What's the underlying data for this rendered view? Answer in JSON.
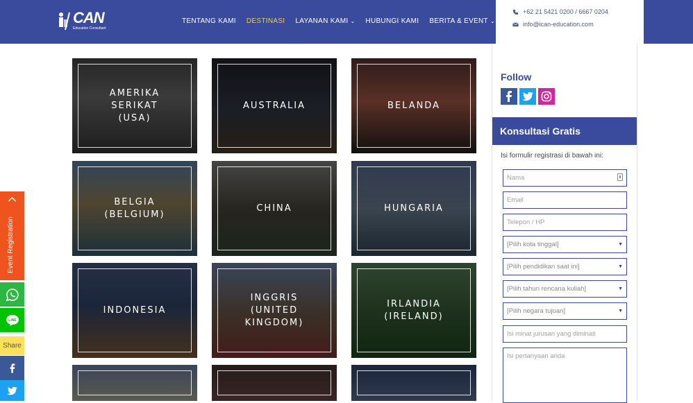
{
  "header": {
    "logo_text": "CAN",
    "logo_sub": "Education Consultant",
    "nav": [
      {
        "label": "TENTANG KAMI",
        "active": false,
        "dropdown": false
      },
      {
        "label": "DESTINASI",
        "active": true,
        "dropdown": false
      },
      {
        "label": "LAYANAN KAMI",
        "active": false,
        "dropdown": true
      },
      {
        "label": "HUBUNGI KAMI",
        "active": false,
        "dropdown": false
      },
      {
        "label": "BERITA & EVENT",
        "active": false,
        "dropdown": true
      }
    ],
    "search_icon": "search-icon",
    "phone": "+62 21 5421 0200 / 6667 0204",
    "email": "info@ican-education.com",
    "brand_color": "#3a4a9c",
    "active_color": "#f0c95a"
  },
  "destinations": [
    {
      "label": "AMERIKA\nSERIKAT\n(USA)"
    },
    {
      "label": "AUSTRALIA"
    },
    {
      "label": "BELANDA"
    },
    {
      "label": "BELGIA\n(BELGIUM)"
    },
    {
      "label": "CHINA"
    },
    {
      "label": "HUNGARIA"
    },
    {
      "label": "INDONESIA"
    },
    {
      "label": "INGGRIS\n(UNITED\nKINGDOM)"
    },
    {
      "label": "IRLANDIA\n(IRELAND)"
    },
    {
      "label": ""
    },
    {
      "label": ""
    },
    {
      "label": ""
    }
  ],
  "sidebar": {
    "follow_title": "Follow",
    "social": [
      "facebook-icon",
      "twitter-icon",
      "instagram-icon"
    ],
    "konsultasi_title": "Konsultasi Gratis",
    "form_intro": "Isi formulir registrasi di bawah ini:",
    "fields": [
      {
        "placeholder": "Nama",
        "type": "text"
      },
      {
        "placeholder": "Email",
        "type": "text"
      },
      {
        "placeholder": "Telepon / HP",
        "type": "text"
      },
      {
        "placeholder": "[Pilih kota tinggal]",
        "type": "select"
      },
      {
        "placeholder": "[Pilih pendidikan saat ini]",
        "type": "select"
      },
      {
        "placeholder": "[Pilih tahun rencana kuliah]",
        "type": "select"
      },
      {
        "placeholder": "[Pilih negara tujuan]",
        "type": "select"
      },
      {
        "placeholder": "Isi minat jurusan yang diminati",
        "type": "text"
      },
      {
        "placeholder": "Isi pertanyaan anda",
        "type": "textarea"
      }
    ]
  },
  "side_tabs": {
    "event_registration": "Event Registration",
    "share_label": "Share",
    "event_color": "#f0541e",
    "whatsapp_color": "#2bb741",
    "line_color": "#00c300",
    "facebook_color": "#3b5998",
    "twitter_color": "#1da1f2"
  }
}
